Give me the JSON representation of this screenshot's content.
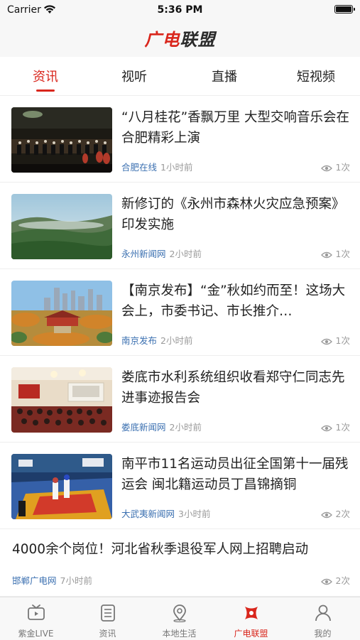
{
  "status_bar": {
    "carrier": "Carrier",
    "time": "5:36 PM"
  },
  "header": {
    "logo_part1": "广电",
    "logo_part2": "联盟"
  },
  "tabs": [
    {
      "label": "资讯",
      "active": true
    },
    {
      "label": "视听",
      "active": false
    },
    {
      "label": "直播",
      "active": false
    },
    {
      "label": "短视频",
      "active": false
    }
  ],
  "news": [
    {
      "title": "“八月桂花”香飘万里 大型交响音乐会在合肥精彩上演",
      "source": "合肥在线",
      "time": "1小时前",
      "views": "1次",
      "thumb": "orchestra-stage-photo"
    },
    {
      "title": "新修订的《永州市森林火灾应急预案》印发实施",
      "source": "永州新闻网",
      "time": "2小时前",
      "views": "1次",
      "thumb": "forest-mountain-photo"
    },
    {
      "title": "【南京发布】“金”秋如约而至！这场大会上，市委书记、市长推介…",
      "source": "南京发布",
      "time": "2小时前",
      "views": "1次",
      "thumb": "city-skyline-photo"
    },
    {
      "title": "娄底市水利系统组织收看郑守仁同志先进事迹报告会",
      "source": "娄底新闻网",
      "time": "2小时前",
      "views": "1次",
      "thumb": "meeting-hall-photo"
    },
    {
      "title": "南平市11名运动员出征全国第十一届残运会 闽北籍运动员丁昌锦摘铜",
      "source": "大武夷新闻网",
      "time": "3小时前",
      "views": "2次",
      "thumb": "taekwondo-match-photo"
    },
    {
      "title": "4000余个岗位！河北省秋季退役军人网上招聘启动",
      "source": "邯郸广电网",
      "time": "7小时前",
      "views": "2次"
    }
  ],
  "bottom_tabs": [
    {
      "label": "紫金LIVE",
      "icon": "tv-icon",
      "active": false
    },
    {
      "label": "资讯",
      "icon": "news-list-icon",
      "active": false
    },
    {
      "label": "本地生活",
      "icon": "location-pin-icon",
      "active": false
    },
    {
      "label": "广电联盟",
      "icon": "alliance-icon",
      "active": true
    },
    {
      "label": "我的",
      "icon": "user-icon",
      "active": false
    }
  ],
  "colors": {
    "accent": "#d9261c",
    "source_link": "#3a6fb0",
    "muted": "#9a9a9a"
  }
}
